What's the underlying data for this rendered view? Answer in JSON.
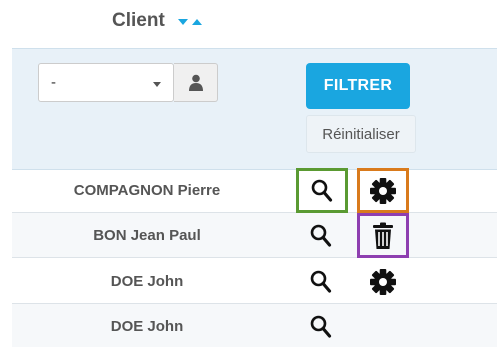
{
  "header": {
    "column_title": "Client"
  },
  "filter": {
    "select_value": "-",
    "filter_button": "FILTRER",
    "reset_button": "Réinitialiser"
  },
  "rows": [
    {
      "name": "COMPAGNON Pierre",
      "actions": [
        "search-icon",
        "gear-icon"
      ]
    },
    {
      "name": "BON Jean Paul",
      "actions": [
        "search-icon",
        "trash-icon"
      ]
    },
    {
      "name": "DOE John",
      "actions": [
        "search-icon",
        "gear-icon"
      ]
    },
    {
      "name": "DOE John",
      "actions": [
        "search-icon"
      ]
    }
  ],
  "colors": {
    "accent": "#1aa6e0",
    "highlight_search": "#5a9a32",
    "highlight_gear": "#d97a1c",
    "highlight_trash": "#8e3fb0"
  }
}
